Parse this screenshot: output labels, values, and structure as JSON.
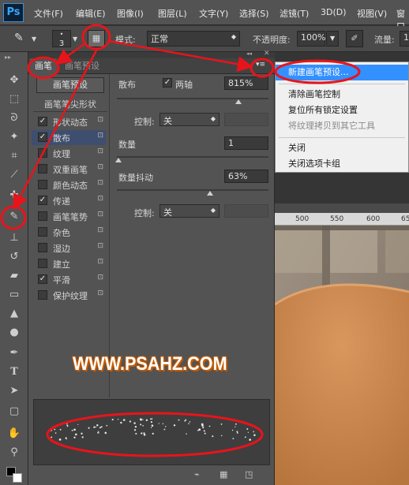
{
  "app": {
    "logo": "Ps"
  },
  "menubar": {
    "items": [
      "文件(F)",
      "编辑(E)",
      "图像(I)",
      "图层(L)",
      "文字(Y)",
      "选择(S)",
      "滤镜(T)",
      "3D(D)",
      "视图(V)",
      "窗口"
    ]
  },
  "options": {
    "brush_size": "3",
    "mode_label": "模式:",
    "mode_value": "正常",
    "opacity_label": "不透明度:",
    "opacity_value": "100%",
    "flow_label": "流量:",
    "flow_value": "1"
  },
  "panel": {
    "tabs": [
      "画笔",
      "画笔预设"
    ],
    "preset_button": "画笔预设",
    "list_header": "画笔笔尖形状",
    "items": [
      {
        "label": "形状动态",
        "checked": true
      },
      {
        "label": "散布",
        "checked": true
      },
      {
        "label": "纹理",
        "checked": false
      },
      {
        "label": "双重画笔",
        "checked": false
      },
      {
        "label": "颜色动态",
        "checked": false
      },
      {
        "label": "传递",
        "checked": true
      },
      {
        "label": "画笔笔势",
        "checked": false
      },
      {
        "label": "杂色",
        "checked": false
      },
      {
        "label": "湿边",
        "checked": false
      },
      {
        "label": "建立",
        "checked": false
      },
      {
        "label": "平滑",
        "checked": true
      },
      {
        "label": "保护纹理",
        "checked": false
      }
    ],
    "scatter_label": "散布",
    "both_axes_label": "两轴",
    "scatter_value": "815%",
    "control_label": "控制:",
    "control_value": "关",
    "count_label": "数量",
    "count_value": "1",
    "count_jitter_label": "数量抖动",
    "count_jitter_value": "63%",
    "control2_label": "控制:",
    "control2_value": "关"
  },
  "flyout": {
    "items": [
      {
        "label": "新建画笔预设...",
        "highlighted": true,
        "disabled": false
      },
      {
        "label": "清除画笔控制",
        "highlighted": false,
        "disabled": false
      },
      {
        "label": "复位所有锁定设置",
        "highlighted": false,
        "disabled": false
      },
      {
        "label": "将纹理拷贝到其它工具",
        "highlighted": false,
        "disabled": true
      },
      {
        "label": "关闭",
        "highlighted": false,
        "disabled": false
      },
      {
        "label": "关闭选项卡组",
        "highlighted": false,
        "disabled": false
      }
    ]
  },
  "ruler": {
    "ticks": [
      "500",
      "550",
      "600",
      "650"
    ]
  },
  "watermark": "WWW.PSAHZ.COM",
  "colors": {
    "annotation_red": "#e8141b",
    "menu_highlight": "#3390ff",
    "canvas_orange": "#c98a55"
  }
}
